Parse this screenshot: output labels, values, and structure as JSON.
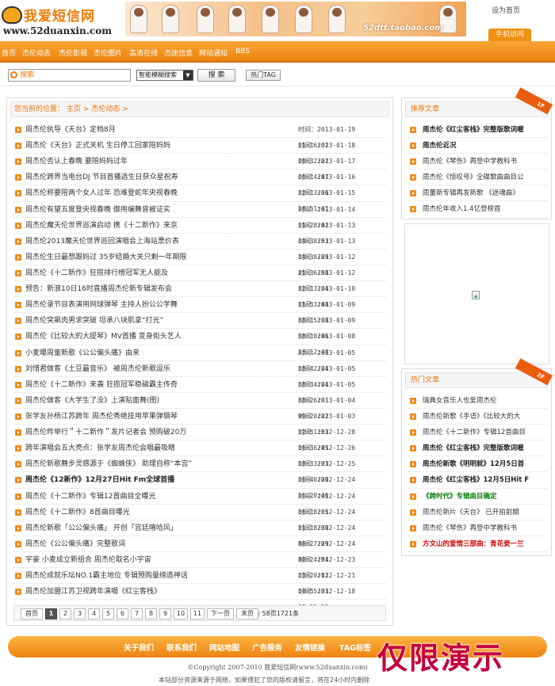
{
  "header": {
    "logo_cn": "我爱短信网",
    "logo_url": "www.52duanxin.com",
    "banner_url": "52dtt.taobao.com",
    "set_home": "设为首页",
    "mobile_visit": "手机访问"
  },
  "nav": [
    "首页",
    "杰伦动态",
    "杰伦影视",
    "杰伦图片",
    "高清在线",
    "杰迷信息",
    "网站通知",
    "BBS"
  ],
  "search": {
    "placeholder": "搜索",
    "mode": "智能模糊搜索",
    "button": "搜 索",
    "hot_tag": "热门TAG"
  },
  "breadcrumb": {
    "prefix": "您当前的位置：",
    "home": "主页",
    "sep": ">",
    "current": "杰伦动态",
    "end": ">"
  },
  "time_label": "时间：",
  "articles": [
    {
      "title": "周杰伦执导《天台》定档8月",
      "time": "2013-01-19 11:16:02",
      "bold": false
    },
    {
      "title": "周杰伦《天台》正式关机 生日停工回家陪妈妈",
      "time": "2013-01-18 10:32:22",
      "bold": false
    },
    {
      "title": "周杰伦否认上春晚 要陪妈妈过年",
      "time": "2013-01-17 10:14:47",
      "bold": false
    },
    {
      "title": "周杰伦跨界当电台DJ 节目首播选生日获众星祝寿",
      "time": "2013-01-16 12:13:36",
      "bold": false
    },
    {
      "title": "周杰伦称要陪两个女人过年 恐难登蛇年央视春晚",
      "time": "2013-01-15 18:51:41",
      "bold": false
    },
    {
      "title": "周杰伦有望五度登央视春晚 御用编舞曾被证实",
      "time": "2013-01-14 11:28:42",
      "bold": false
    },
    {
      "title": "周杰伦魔天伦世界巡演启动 携《十二新作》来京",
      "time": "2013-01-13 14:38:53",
      "bold": false
    },
    {
      "title": "周杰伦2013魔天伦世界巡回演唱会上海站票价表",
      "time": "2013-01-13 14:38:29",
      "bold": false
    },
    {
      "title": "周杰伦生日最想跟妈过 35岁结婚大关只剩一年期限",
      "time": "2013-01-12 21:36:58",
      "bold": false
    },
    {
      "title": "周杰伦《十二新作》狂揽排行榜冠军无人能及",
      "time": "2013-01-12 12:13:34",
      "bold": false
    },
    {
      "title": "预告：新浪10日16时直播周杰伦新专辑发布会",
      "time": "2013-01-10 11:53:48",
      "bold": false
    },
    {
      "title": "周杰伦录节目表演用网球弹琴 主持人扮公公学舞",
      "time": "2013-01-09 18:15:08",
      "bold": false
    },
    {
      "title": "周杰伦突飙肉男求突破 坦承八块肌拿“打光”",
      "time": "2013-01-09 18:10:46",
      "bold": false
    },
    {
      "title": "周杰伦《比较大的大提琴》MV首播 变身街头艺人",
      "time": "2013-01-08 13:12:40",
      "bold": false
    },
    {
      "title": "小麦曝周董新歌《公公偏头痛》由来",
      "time": "2013-01-05 18:42:24",
      "bold": false
    },
    {
      "title": "刘惜君做客《土豆最音乐》 被周杰伦新歌逗乐",
      "time": "2013-01-05 18:34:24",
      "bold": false
    },
    {
      "title": "周杰伦《十二新作》来袭 狂揽冠军稳磁霸主传奇",
      "time": "2013-01-05 18:26:01",
      "bold": false
    },
    {
      "title": "周杰伦做客《大学生了没》上演贴面舞(图)",
      "time": "2013-01-04 09:20:22",
      "bold": false
    },
    {
      "title": "张学友孙杨江苏跨年 周杰伦秀绝技用苹果弹钢琴",
      "time": "2013-01-03 12:51:53",
      "bold": false
    },
    {
      "title": "周杰伦昨举行＂十二新作＂发片记者会 预购破20万",
      "time": "2012-12-28 16:36:45",
      "bold": false
    },
    {
      "title": "跨年演唱会五大亮点：张学友周杰伦会唱最吸睛",
      "time": "2012-12-26 18:33:33",
      "bold": false
    },
    {
      "title": "周杰伦新歌舞步灵感源于《蜘蛛侠》 助理自称“本宫”",
      "time": "2012-12-25 16:40:20",
      "bold": false
    },
    {
      "title": "周杰伦《12新作》12月27日Hit Fm全球首播",
      "time": "2012-12-24 16:20:46",
      "bold": true
    },
    {
      "title": "周杰伦《十二新作》专辑12首曲目全曝光",
      "time": "2012-12-24 16:18:05",
      "bold": false
    },
    {
      "title": "周杰伦《十二新作》8首曲目曝光",
      "time": "2012-12-24 11:18:30",
      "bold": false
    },
    {
      "title": "周杰伦新歌「公公偏头痛」 开创「宫廷嘻哈风」",
      "time": "2012-12-24 08:27:29",
      "bold": false
    },
    {
      "title": "周杰伦《公公偏头痛》完整歌词",
      "time": "2012-12-24 08:24:54",
      "bold": false
    },
    {
      "title": "宇豪 小麦成立新组合 周杰伦取名小宇宙",
      "time": "2012-12-23 13:20:12",
      "bold": false
    },
    {
      "title": "周杰伦成就乐坛NO.1霸主地位 专辑预购量缔造神话",
      "time": "2012-12-21 14:55:33",
      "bold": false
    },
    {
      "title": "周杰伦加盟江苏卫视跨年演唱《红尘客栈》",
      "time": "2012-12-18 09:51:15",
      "bold": false
    }
  ],
  "pagination": {
    "pages": [
      "首页",
      "1",
      "2",
      "3",
      "4",
      "5",
      "6",
      "7",
      "8",
      "9",
      "10",
      "11",
      "下一页",
      "末页"
    ],
    "current": "1",
    "summary": "共 58页1721条"
  },
  "recommended": {
    "title": "推荐文章",
    "badge": "1F",
    "items": [
      {
        "text": "周杰伦《红尘客栈》完整版歌词喔",
        "style": "bold"
      },
      {
        "text": "周杰伦近况",
        "style": "bold"
      },
      {
        "text": "周杰伦《琴伤》再登中学教科书",
        "style": "normal"
      },
      {
        "text": "周杰伦《惊叹号》全碟歌曲曲目公",
        "style": "normal"
      },
      {
        "text": "周董新专辑再发新歌 《迷魂曲》",
        "style": "normal"
      },
      {
        "text": "周杰伦年收入1.4亿登榜首",
        "style": "normal"
      }
    ]
  },
  "hot": {
    "title": "热门文章",
    "badge": "2F",
    "items": [
      {
        "text": "瑞典女音乐人也爱周杰伦",
        "style": "normal"
      },
      {
        "text": "周杰伦新歌《手语》《比较大的大",
        "style": "normal"
      },
      {
        "text": "周杰伦《十二新作》专辑12首曲目",
        "style": "normal"
      },
      {
        "text": "周杰伦《红尘客栈》完整版歌词喔",
        "style": "bold"
      },
      {
        "text": "周杰伦新歌《明明就》12月5日首",
        "style": "bold"
      },
      {
        "text": "周杰伦《红尘客栈》12月5日Hit F",
        "style": "bold"
      },
      {
        "text": "《跨时代》专辑曲目确定",
        "style": "green"
      },
      {
        "text": "周杰伦新片《天台》 已开拍前期",
        "style": "normal"
      },
      {
        "text": "周杰伦《琴伤》再登中学教科书",
        "style": "normal"
      },
      {
        "text": "方文山的爱情三部曲：青花瓷一兰",
        "style": "red"
      }
    ]
  },
  "footer": {
    "links": [
      "关于我们",
      "联系我们",
      "网站地图",
      "广告服务",
      "友情链接",
      "TAG标签"
    ],
    "copyright": "©Copyright 2007-2010 我爱短信网(www.52duanxin.com)",
    "notice": "本站部分资源来源于网络，如果侵犯了您的版权请留言，将在24小时内删除"
  },
  "watermark": "仅限演示"
}
